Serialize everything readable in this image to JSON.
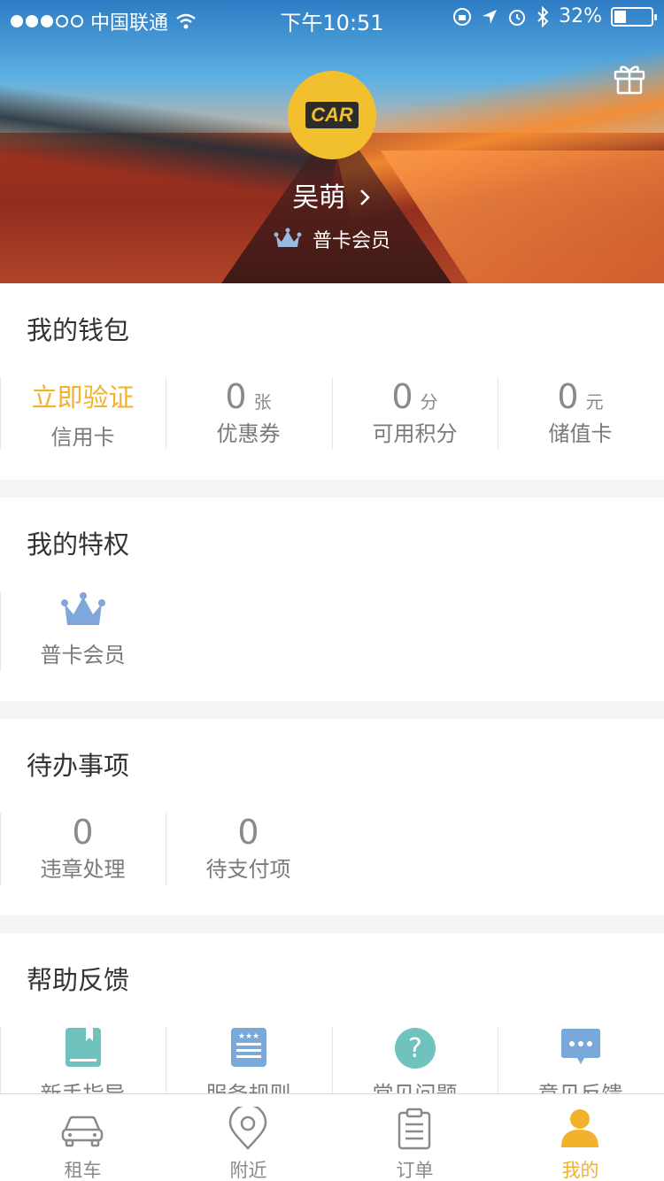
{
  "status_bar": {
    "carrier": "中国联通",
    "time": "下午10:51",
    "battery": "32%",
    "battery_level": 0.32
  },
  "profile": {
    "avatar_logo": "CAR",
    "name": "吴萌",
    "member_level": "普卡会员"
  },
  "wallet": {
    "title": "我的钱包",
    "items": [
      {
        "value": "立即验证",
        "unit": "",
        "label": "信用卡"
      },
      {
        "value": "0",
        "unit": "张",
        "label": "优惠券"
      },
      {
        "value": "0",
        "unit": "分",
        "label": "可用积分"
      },
      {
        "value": "0",
        "unit": "元",
        "label": "储值卡"
      }
    ]
  },
  "privileges": {
    "title": "我的特权",
    "items": [
      {
        "label": "普卡会员",
        "icon": "crown-icon"
      }
    ]
  },
  "todo": {
    "title": "待办事项",
    "items": [
      {
        "value": "0",
        "label": "违章处理"
      },
      {
        "value": "0",
        "label": "待支付项"
      }
    ]
  },
  "help": {
    "title": "帮助反馈",
    "items": [
      {
        "label": "新手指导",
        "icon": "guide-book-icon"
      },
      {
        "label": "服务规则",
        "icon": "rules-doc-icon"
      },
      {
        "label": "常见问题",
        "icon": "question-icon"
      },
      {
        "label": "意见反馈",
        "icon": "chat-bubble-icon"
      }
    ]
  },
  "tabbar": {
    "tabs": [
      {
        "label": "租车",
        "icon": "car-icon"
      },
      {
        "label": "附近",
        "icon": "location-pin-icon"
      },
      {
        "label": "订单",
        "icon": "clipboard-icon"
      },
      {
        "label": "我的",
        "icon": "person-icon",
        "active": true
      }
    ]
  },
  "colors": {
    "accent": "#f2b22b",
    "crown": "#7fa7d9",
    "help_teal": "#6fc2bd",
    "help_blue": "#7aa8d8"
  }
}
